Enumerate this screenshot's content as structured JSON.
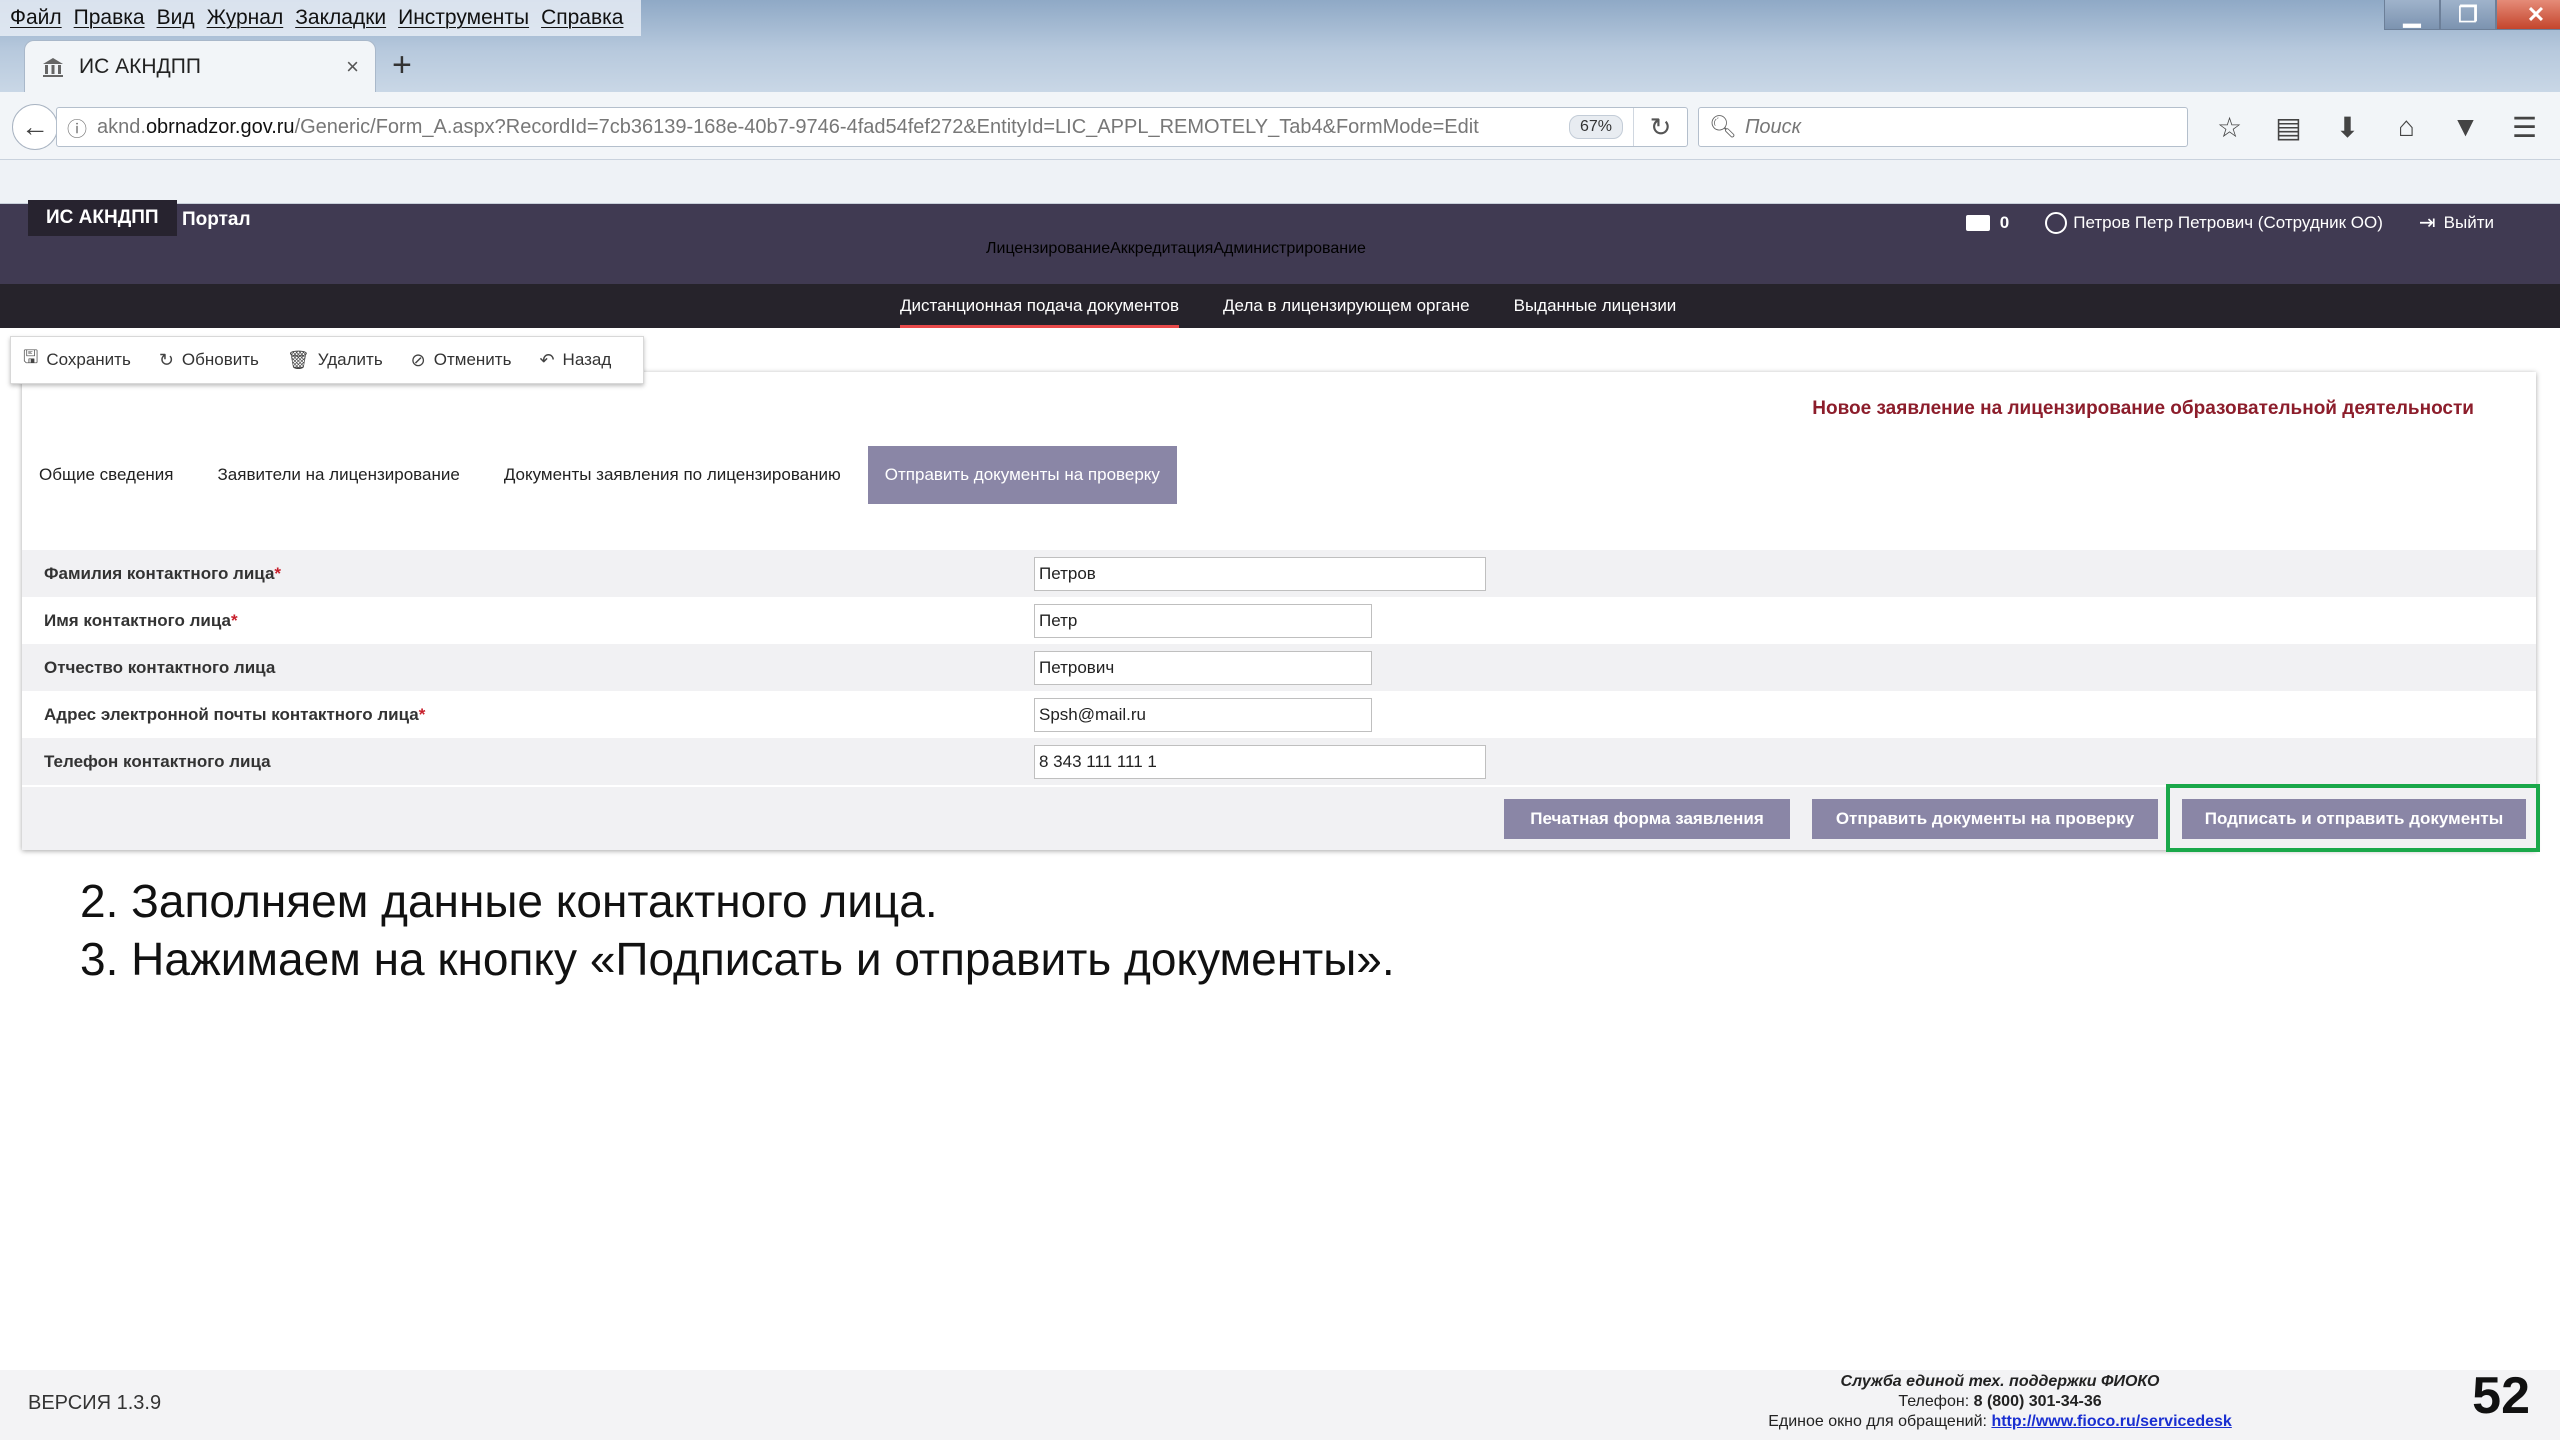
{
  "browser": {
    "menu": [
      "Файл",
      "Правка",
      "Вид",
      "Журнал",
      "Закладки",
      "Инструменты",
      "Справка"
    ],
    "tab_title": "ИС АКНДПП",
    "tab_close": "×",
    "new_tab": "+",
    "url_domain": "aknd.obrnadzor.gov.ru",
    "url_prefix": "aknd.",
    "url_host": "obrnadzor.gov.ru",
    "url_path": "/Generic/Form_A.aspx?RecordId=7cb36139-168e-40b7-9746-4fad54fef272&EntityId=LIC_APPL_REMOTELY_Tab4&FormMode=Edit",
    "zoom": "67%",
    "search_placeholder": "Поиск",
    "window_controls": {
      "min": "▁",
      "max": "❐",
      "close": "✕"
    }
  },
  "app": {
    "brand": "ИС АКНДПП",
    "portal": "Портал",
    "messages_count": "0",
    "user": "Петров Петр Петрович (Сотрудник ОО)",
    "logout": "Выйти",
    "main_nav": [
      "Лицензирование",
      "Аккредитация",
      "Администрирование"
    ],
    "main_nav_active": 0,
    "sub_nav": [
      "Дистанционная подача документов",
      "Дела в лицензирующем органе",
      "Выданные лицензии"
    ],
    "sub_nav_active": 0
  },
  "toolbar": {
    "save": "Сохранить",
    "refresh": "Обновить",
    "delete": "Удалить",
    "cancel": "Отменить",
    "back": "Назад"
  },
  "form": {
    "title": "Новое заявление на лицензирование образовательной деятельности",
    "tabs": [
      "Общие сведения",
      "Заявители на лицензирование",
      "Документы заявления по лицензированию",
      "Отправить документы на проверку"
    ],
    "active_tab": 3,
    "fields": {
      "last_name": {
        "label": "Фамилия контактного лица",
        "required": true,
        "value": "Петров"
      },
      "first_name": {
        "label": "Имя контактного лица",
        "required": true,
        "value": "Петр"
      },
      "middle_name": {
        "label": "Отчество контактного лица",
        "required": false,
        "value": "Петрович"
      },
      "email": {
        "label": "Адрес электронной почты контактного лица",
        "required": true,
        "value": "Spsh@mail.ru"
      },
      "phone": {
        "label": "Телефон контактного лица",
        "required": false,
        "value": "8 343 111 111 1"
      }
    },
    "required_mark": "*",
    "buttons": {
      "print": "Печатная форма заявления",
      "send_check": "Отправить документы на проверку",
      "sign_send": "Подписать и отправить документы"
    },
    "highlight_color": "#1aa84a"
  },
  "slide": {
    "step2": "2. Заполняем данные контактного лица.",
    "step3": "3. Нажимаем на кнопку «Подписать и отправить документы».",
    "page_number": "52"
  },
  "footer": {
    "version": "ВЕРСИЯ 1.3.9",
    "support_title": "Служба единой тех. поддержки ФИОКО",
    "phone_label": "Телефон:",
    "phone": "8 (800) 301-34-36",
    "window_label": "Единое окно для обращений:",
    "window_url": "http://www.fioco.ru/servicedesk"
  },
  "colors": {
    "accent_red": "#e8494a",
    "header_dark": "#403a52",
    "subnav_dark": "#26232b",
    "button_purple": "#8a86a6",
    "title_maroon": "#8c1d2b"
  }
}
